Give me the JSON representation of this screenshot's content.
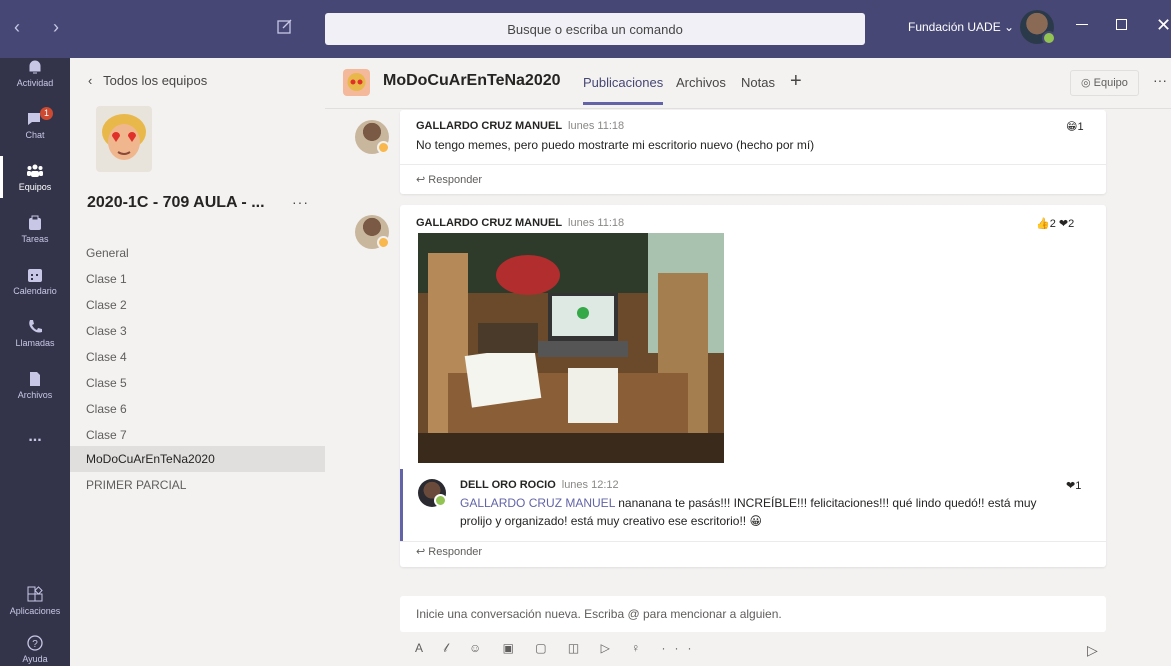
{
  "topbar": {
    "nav": "‹ ›",
    "search_placeholder": "Busque o escriba un comando",
    "org": "Fundación UADE ⌄"
  },
  "rail": [
    {
      "label": "Actividad",
      "icon": "bell-icon"
    },
    {
      "label": "Chat",
      "icon": "chat-icon",
      "badge": "1"
    },
    {
      "label": "Equipos",
      "icon": "teams-icon"
    },
    {
      "label": "Tareas",
      "icon": "assignments-icon"
    },
    {
      "label": "Calendario",
      "icon": "calendar-icon"
    },
    {
      "label": "Llamadas",
      "icon": "phone-icon"
    },
    {
      "label": "Archivos",
      "icon": "files-icon"
    },
    {
      "label": "...",
      "icon": "more-icon"
    },
    {
      "label": "Aplicaciones",
      "icon": "apps-icon"
    },
    {
      "label": "Ayuda",
      "icon": "help-icon"
    }
  ],
  "panel": {
    "back_label": "Todos los equipos",
    "team_name": "2020-1C - 709 AULA - ...",
    "more": "···",
    "channels": [
      "General",
      "Clase 1",
      "Clase 2",
      "Clase 3",
      "Clase 4",
      "Clase 5",
      "Clase 6",
      "Clase 7",
      "MoDoCuArEnTeNa2020",
      "PRIMER PARCIAL"
    ]
  },
  "header": {
    "title": "MoDoCuArEnTeNa2020",
    "tabs": [
      "Publicaciones",
      "Archivos",
      "Notas"
    ],
    "plus": "+",
    "equipo": "◎ Equipo",
    "more": "···"
  },
  "messages": [
    {
      "author": "GALLARDO CRUZ MANUEL",
      "time": "lunes 11:18",
      "text": "No tengo memes, pero puedo mostrarte mi escritorio nuevo (hecho por mí)",
      "reaction": "😁1",
      "reply": "↩ Responder"
    },
    {
      "author": "GALLARDO CRUZ MANUEL",
      "time": "lunes 11:18",
      "reaction": "👍2 ❤2",
      "reply_author": "DELL ORO ROCIO",
      "reply_time": "lunes 12:12",
      "reply_mention": "GALLARDO CRUZ MANUEL",
      "reply_text": " nananana te pasás!!! INCREÍBLE!!! felicitaciones!!! qué lindo quedó!! está muy prolijo y organizado! está muy creativo ese escritorio!! 😀",
      "reply_reaction": "❤1",
      "reply": "↩ Responder"
    }
  ],
  "compose": {
    "placeholder": "Inicie una conversación nueva. Escriba @ para mencionar a alguien.",
    "tools": "A 𝓁 ☺ ▣ ▢ ◫ ▷ ♀ ···",
    "send": "▷"
  }
}
